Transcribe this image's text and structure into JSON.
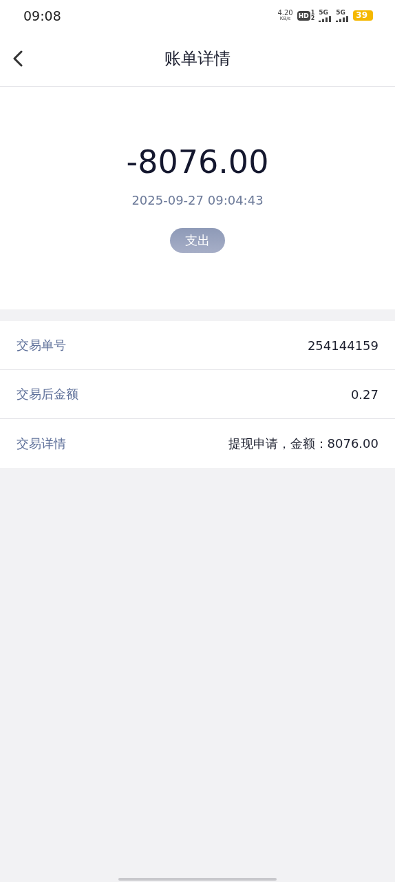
{
  "status_bar": {
    "time": "09:08",
    "net_speed": "4.20",
    "net_unit": "KB/s",
    "hd": "HD",
    "sims": [
      "1",
      "2"
    ],
    "signals": [
      {
        "label": "5G"
      },
      {
        "label": "5G"
      }
    ],
    "battery": "39"
  },
  "header": {
    "title": "账单详情"
  },
  "summary": {
    "amount": "-8076.00",
    "datetime": "2025-09-27 09:04:43",
    "tag": "支出"
  },
  "details": [
    {
      "label": "交易单号",
      "value": "254144159"
    },
    {
      "label": "交易后金额",
      "value": "0.27"
    },
    {
      "label": "交易详情",
      "value": "提现申请，金额：8076.00"
    }
  ]
}
